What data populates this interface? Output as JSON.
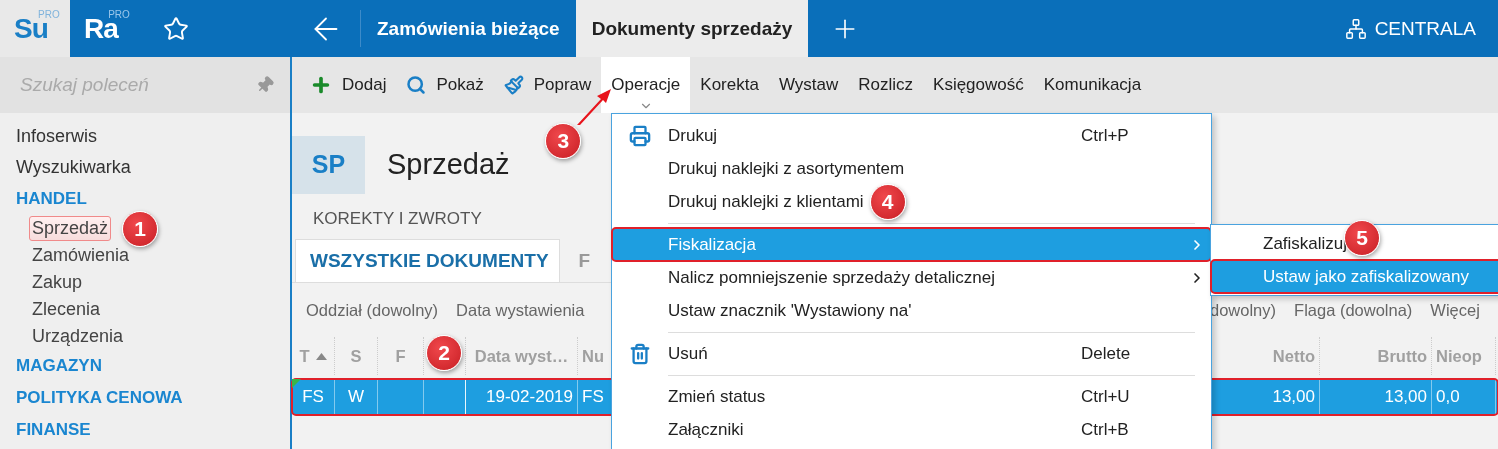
{
  "topbar": {
    "logo_su": "Su",
    "logo_su_badge": "PRO",
    "logo_ra": "Ra",
    "logo_ra_badge": "PRO",
    "tabs": [
      {
        "label": "Zamówienia bieżące",
        "selected": false
      },
      {
        "label": "Dokumenty sprzedaży",
        "selected": true
      }
    ],
    "branch": "CENTRALA"
  },
  "sidebar": {
    "search_placeholder": "Szukaj poleceń",
    "items": [
      {
        "label": "Infoserwis",
        "kind": "link"
      },
      {
        "label": "Wyszukiwarka",
        "kind": "link"
      },
      {
        "label": "HANDEL",
        "kind": "section",
        "children": [
          {
            "label": "Sprzedaż",
            "highlighted": true,
            "callout": "1"
          },
          {
            "label": "Zamówienia",
            "highlighted": false
          },
          {
            "label": "Zakup",
            "highlighted": false
          },
          {
            "label": "Zlecenia",
            "highlighted": false
          },
          {
            "label": "Urządzenia",
            "highlighted": false
          }
        ]
      },
      {
        "label": "MAGAZYN",
        "kind": "section"
      },
      {
        "label": "POLITYKA CENOWA",
        "kind": "section"
      },
      {
        "label": "FINANSE",
        "kind": "section"
      }
    ]
  },
  "toolbar": [
    {
      "label": "Dodaj",
      "kind": "add",
      "open": false
    },
    {
      "label": "Pokaż",
      "kind": "view",
      "open": false
    },
    {
      "label": "Popraw",
      "kind": "edit",
      "open": false
    },
    {
      "label": "Operacje",
      "kind": "menu",
      "open": true,
      "callout": "3"
    },
    {
      "label": "Korekta",
      "kind": "menu",
      "open": false
    },
    {
      "label": "Wystaw",
      "kind": "menu",
      "open": false
    },
    {
      "label": "Rozlicz",
      "kind": "menu",
      "open": false
    },
    {
      "label": "Księgowość",
      "kind": "menu",
      "open": false
    },
    {
      "label": "Komunikacja",
      "kind": "menu",
      "open": false
    }
  ],
  "document": {
    "code": "SP",
    "title": "Sprzedaż",
    "group": "KOREKTY I ZWROTY",
    "tabs": [
      {
        "label": "WSZYSTKIE DOKUMENTY",
        "selected": true
      },
      {
        "label": "F",
        "selected": false
      }
    ],
    "filters_left": [
      "Oddział (dowolny)",
      "Data wystawienia"
    ],
    "filters_right": [
      "dowolny)",
      "Flaga (dowolna)",
      "Więcej"
    ]
  },
  "table": {
    "columns": [
      {
        "label": "T",
        "sorted": true
      },
      {
        "label": "S",
        "sorted": false
      },
      {
        "label": "F",
        "sorted": false
      },
      {
        "label": "Data wyst…",
        "sorted": false
      },
      {
        "label": "Nu",
        "sorted": false
      },
      {
        "label": "Netto",
        "sorted": false
      },
      {
        "label": "Brutto",
        "sorted": false
      },
      {
        "label": "Nieop",
        "sorted": false
      }
    ],
    "rows": [
      {
        "cells": [
          "FS",
          "W",
          null,
          "19-02-2019",
          "FS",
          "13,00",
          "13,00",
          "0,0"
        ],
        "selected": true,
        "highlighted": true,
        "callout": "2"
      }
    ]
  },
  "menu": {
    "items": [
      {
        "kind": "print",
        "label": "Drukuj",
        "shortcut": "Ctrl+P",
        "submenu": false,
        "selected": false
      },
      {
        "kind": "item",
        "label": "Drukuj naklejki z asortymentem",
        "submenu": false,
        "selected": false
      },
      {
        "kind": "item",
        "label": "Drukuj naklejki z klientami",
        "submenu": false,
        "selected": false,
        "callout": "4"
      },
      {
        "kind": "separator"
      },
      {
        "kind": "item",
        "label": "Fiskalizacja",
        "submenu": true,
        "selected": true
      },
      {
        "kind": "item",
        "label": "Nalicz pomniejszenie sprzedaży detalicznej",
        "submenu": true,
        "selected": false
      },
      {
        "kind": "item",
        "label": "Ustaw znacznik 'Wystawiony na'",
        "submenu": false,
        "selected": false
      },
      {
        "kind": "separator"
      },
      {
        "kind": "delete",
        "label": "Usuń",
        "shortcut": "Delete",
        "submenu": false,
        "selected": false
      },
      {
        "kind": "separator"
      },
      {
        "kind": "item",
        "label": "Zmień status",
        "shortcut": "Ctrl+U",
        "submenu": false,
        "selected": false
      },
      {
        "kind": "item",
        "label": "Załączniki",
        "shortcut": "Ctrl+B",
        "submenu": false,
        "selected": false
      }
    ]
  },
  "submenu": {
    "items": [
      {
        "label": "Zafiskalizuj",
        "selected": false,
        "callout": "5"
      },
      {
        "label": "Ustaw jako zafiskalizowany",
        "selected": true
      }
    ]
  }
}
